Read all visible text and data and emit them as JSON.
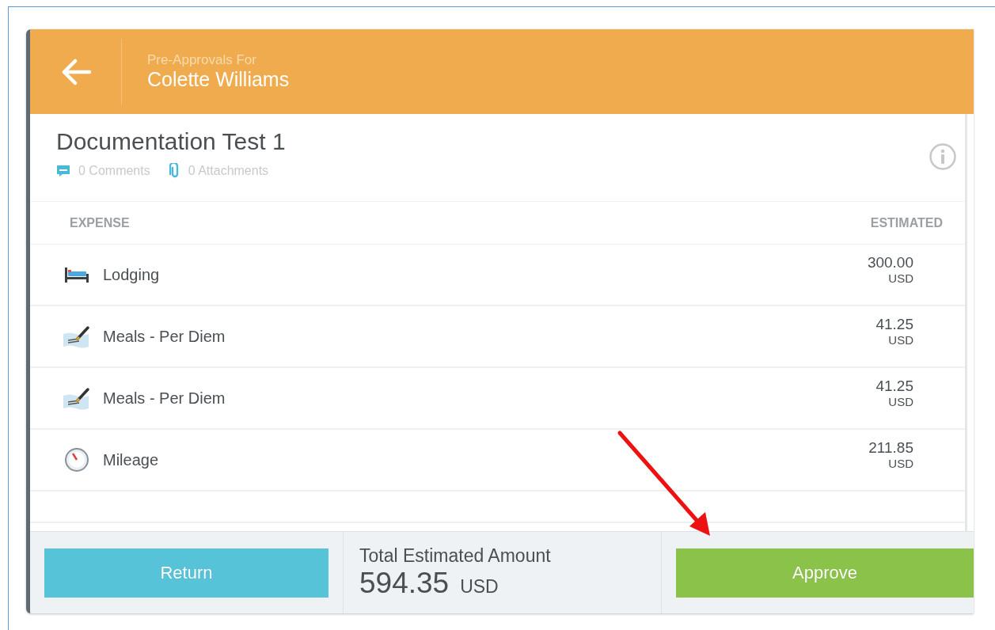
{
  "header": {
    "subtitle": "Pre-Approvals For",
    "title": "Colette Williams"
  },
  "report": {
    "title": "Documentation Test 1",
    "comments": "0 Comments",
    "attachments": "0 Attachments"
  },
  "table": {
    "columns": [
      "EXPENSE",
      "ESTIMATED"
    ],
    "rows": [
      {
        "kind": "lodging",
        "name": "Lodging",
        "amount": "300.00",
        "currency": "USD"
      },
      {
        "kind": "meals",
        "name": "Meals - Per Diem",
        "amount": "41.25",
        "currency": "USD"
      },
      {
        "kind": "meals",
        "name": "Meals - Per Diem",
        "amount": "41.25",
        "currency": "USD"
      },
      {
        "kind": "mileage",
        "name": "Mileage",
        "amount": "211.85",
        "currency": "USD"
      }
    ]
  },
  "footer": {
    "return_button": "Return",
    "total_label": "Total Estimated Amount",
    "total_amount": "594.35",
    "total_currency": "USD",
    "approve_button": "Approve"
  }
}
